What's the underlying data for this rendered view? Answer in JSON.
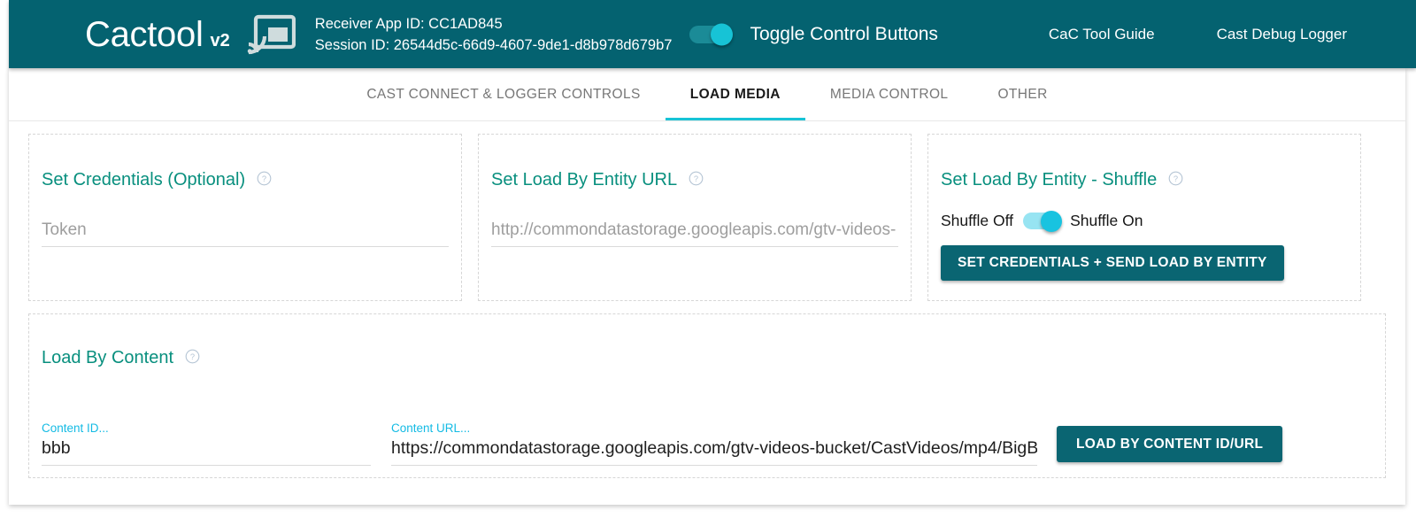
{
  "colors": {
    "header_teal": "#046270",
    "accent_cyan": "#17c3d6",
    "title_teal": "#088f7e",
    "label_cyan": "#14bbe4",
    "button_teal": "#0a6572"
  },
  "header": {
    "brand_name": "Cactool",
    "brand_version": "v2",
    "cast_icon": "cast-icon",
    "receiver_app_id_line": "Receiver App ID: CC1AD845",
    "session_id_line": "Session ID: 26544d5c-66d9-4607-9de1-d8b978d679b7",
    "control_toggle": {
      "label": "Toggle Control Buttons",
      "state": "on"
    },
    "links": [
      {
        "label": "CaC Tool Guide"
      },
      {
        "label": "Cast Debug Logger"
      }
    ]
  },
  "tabs": [
    {
      "label": "CAST CONNECT & LOGGER CONTROLS",
      "active": false
    },
    {
      "label": "LOAD MEDIA",
      "active": true
    },
    {
      "label": "MEDIA CONTROL",
      "active": false
    },
    {
      "label": "OTHER",
      "active": false
    }
  ],
  "cards": {
    "set_credentials": {
      "title": "Set Credentials (Optional)",
      "help_icon": "help-circle-icon",
      "token_field": {
        "placeholder": "Token",
        "value": ""
      }
    },
    "set_load_by_entity_url": {
      "title": "Set Load By Entity URL",
      "help_icon": "help-circle-icon",
      "url_field": {
        "placeholder": "http://commondatastorage.googleapis.com/gtv-videos-",
        "value": ""
      }
    },
    "set_load_by_entity_shuffle": {
      "title": "Set Load By Entity - Shuffle",
      "help_icon": "help-circle-icon",
      "shuffle_off_label": "Shuffle Off",
      "shuffle_on_label": "Shuffle On",
      "shuffle_state": "on",
      "submit_button": "SET CREDENTIALS + SEND LOAD BY ENTITY"
    },
    "load_by_content": {
      "title": "Load By Content",
      "help_icon": "help-circle-icon",
      "content_id_field": {
        "label": "Content ID...",
        "value": "bbb"
      },
      "content_url_field": {
        "label": "Content URL...",
        "value": "https://commondatastorage.googleapis.com/gtv-videos-bucket/CastVideos/mp4/BigB"
      },
      "submit_button": "LOAD BY CONTENT ID/URL"
    }
  }
}
